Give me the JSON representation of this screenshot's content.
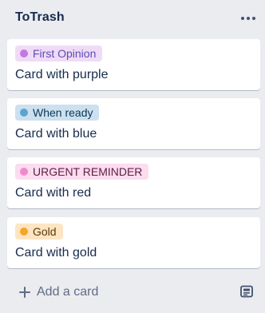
{
  "list": {
    "title": "ToTrash",
    "add_card_label": "Add a card",
    "more_icon": "ellipsis-icon",
    "template_icon": "card-template-icon"
  },
  "cards": [
    {
      "label": "First Opinion",
      "label_bg": "#efdbf7",
      "label_dot": "#c377e0",
      "label_fg": "#5e4db2",
      "title": "Card with purple"
    },
    {
      "label": "When ready",
      "label_bg": "#cce0ef",
      "label_dot": "#5ba4cf",
      "label_fg": "#0c3953",
      "title": "Card with blue"
    },
    {
      "label": "URGENT REMINDER",
      "label_bg": "#fcdcef",
      "label_dot": "#f18acb",
      "label_fg": "#5d1f46",
      "title": "Card with red"
    },
    {
      "label": "Gold",
      "label_bg": "#fde5c3",
      "label_dot": "#f5a623",
      "label_fg": "#5a3b06",
      "title": "Card with gold"
    }
  ]
}
